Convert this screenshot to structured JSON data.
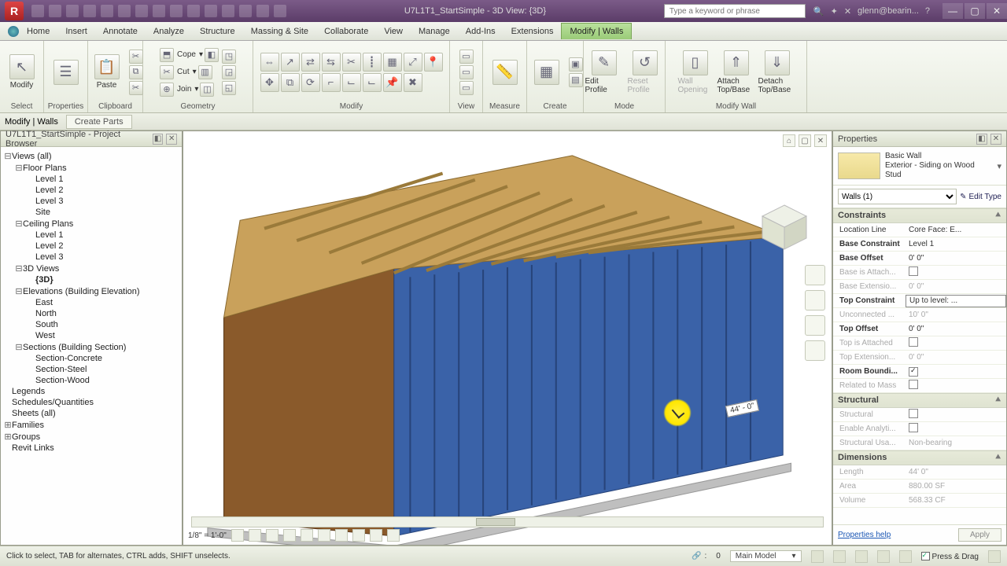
{
  "title": "U7L1T1_StartSimple - 3D View: {3D}",
  "search_placeholder": "Type a keyword or phrase",
  "username": "glenn@bearin...",
  "menu": {
    "tabs": [
      "Home",
      "Insert",
      "Annotate",
      "Analyze",
      "Structure",
      "Massing & Site",
      "Collaborate",
      "View",
      "Manage",
      "Add-Ins",
      "Extensions",
      "Modify | Walls"
    ],
    "active_index": 11
  },
  "ribbon": {
    "panels": {
      "select": "Select",
      "properties": "Properties",
      "clipboard": "Clipboard",
      "geometry": "Geometry",
      "modify": "Modify",
      "view": "View",
      "measure": "Measure",
      "create": "Create",
      "mode": "Mode",
      "modify_wall": "Modify Wall"
    },
    "buttons": {
      "modify": "Modify",
      "paste": "Paste",
      "cope": "Cope",
      "cut": "Cut",
      "join": "Join",
      "edit_profile": "Edit Profile",
      "reset_profile": "Reset Profile",
      "wall_opening": "Wall Opening",
      "attach": "Attach Top/Base",
      "detach": "Detach Top/Base"
    }
  },
  "optionbar": {
    "context": "Modify | Walls",
    "create_parts": "Create Parts"
  },
  "browser": {
    "title": "U7L1T1_StartSimple - Project Browser",
    "views": "Views (all)",
    "floor_plans": "Floor Plans",
    "levels": [
      "Level 1",
      "Level 2",
      "Level 3",
      "Site"
    ],
    "ceiling_plans": "Ceiling Plans",
    "c_levels": [
      "Level 1",
      "Level 2",
      "Level 3"
    ],
    "threed": "3D Views",
    "threed_item": "{3D}",
    "elevations": "Elevations (Building Elevation)",
    "elev_items": [
      "East",
      "North",
      "South",
      "West"
    ],
    "sections": "Sections (Building Section)",
    "section_items": [
      "Section-Concrete",
      "Section-Steel",
      "Section-Wood"
    ],
    "legends": "Legends",
    "schedules": "Schedules/Quantities",
    "sheets": "Sheets (all)",
    "families": "Families",
    "groups": "Groups",
    "links": "Revit Links"
  },
  "viewport": {
    "scale": "1/8\" = 1'-0\"",
    "dim": "44' - 0\""
  },
  "props": {
    "title": "Properties",
    "family": "Basic Wall",
    "type": "Exterior - Siding on Wood Stud",
    "filter": "Walls (1)",
    "edit_type": "Edit Type",
    "groups": {
      "constraints": "Constraints",
      "structural": "Structural",
      "dimensions": "Dimensions"
    },
    "rows": {
      "location_line": {
        "k": "Location Line",
        "v": "Core Face: E..."
      },
      "base_constraint": {
        "k": "Base Constraint",
        "v": "Level 1"
      },
      "base_offset": {
        "k": "Base Offset",
        "v": "0'  0\""
      },
      "base_attached": {
        "k": "Base is Attach...",
        "v": ""
      },
      "base_ext": {
        "k": "Base Extensio...",
        "v": "0'  0\""
      },
      "top_constraint": {
        "k": "Top Constraint",
        "v": "Up to level: ..."
      },
      "unconnected": {
        "k": "Unconnected ...",
        "v": "10'  0\""
      },
      "top_offset": {
        "k": "Top Offset",
        "v": "0'  0\""
      },
      "top_attached": {
        "k": "Top is Attached",
        "v": ""
      },
      "top_ext": {
        "k": "Top Extension...",
        "v": "0'  0\""
      },
      "room_bound": {
        "k": "Room Boundi...",
        "v": ""
      },
      "related_mass": {
        "k": "Related to Mass",
        "v": ""
      },
      "structural": {
        "k": "Structural",
        "v": ""
      },
      "enable_analytic": {
        "k": "Enable Analyti...",
        "v": ""
      },
      "structural_usage": {
        "k": "Structural Usa...",
        "v": "Non-bearing"
      },
      "length": {
        "k": "Length",
        "v": "44'  0\""
      },
      "area": {
        "k": "Area",
        "v": "880.00 SF"
      },
      "volume": {
        "k": "Volume",
        "v": "568.33 CF"
      }
    },
    "help": "Properties help",
    "apply": "Apply"
  },
  "status": {
    "hint": "Click to select, TAB for alternates, CTRL adds, SHIFT unselects.",
    "sel": "0",
    "model": "Main Model",
    "press_drag": "Press & Drag"
  }
}
